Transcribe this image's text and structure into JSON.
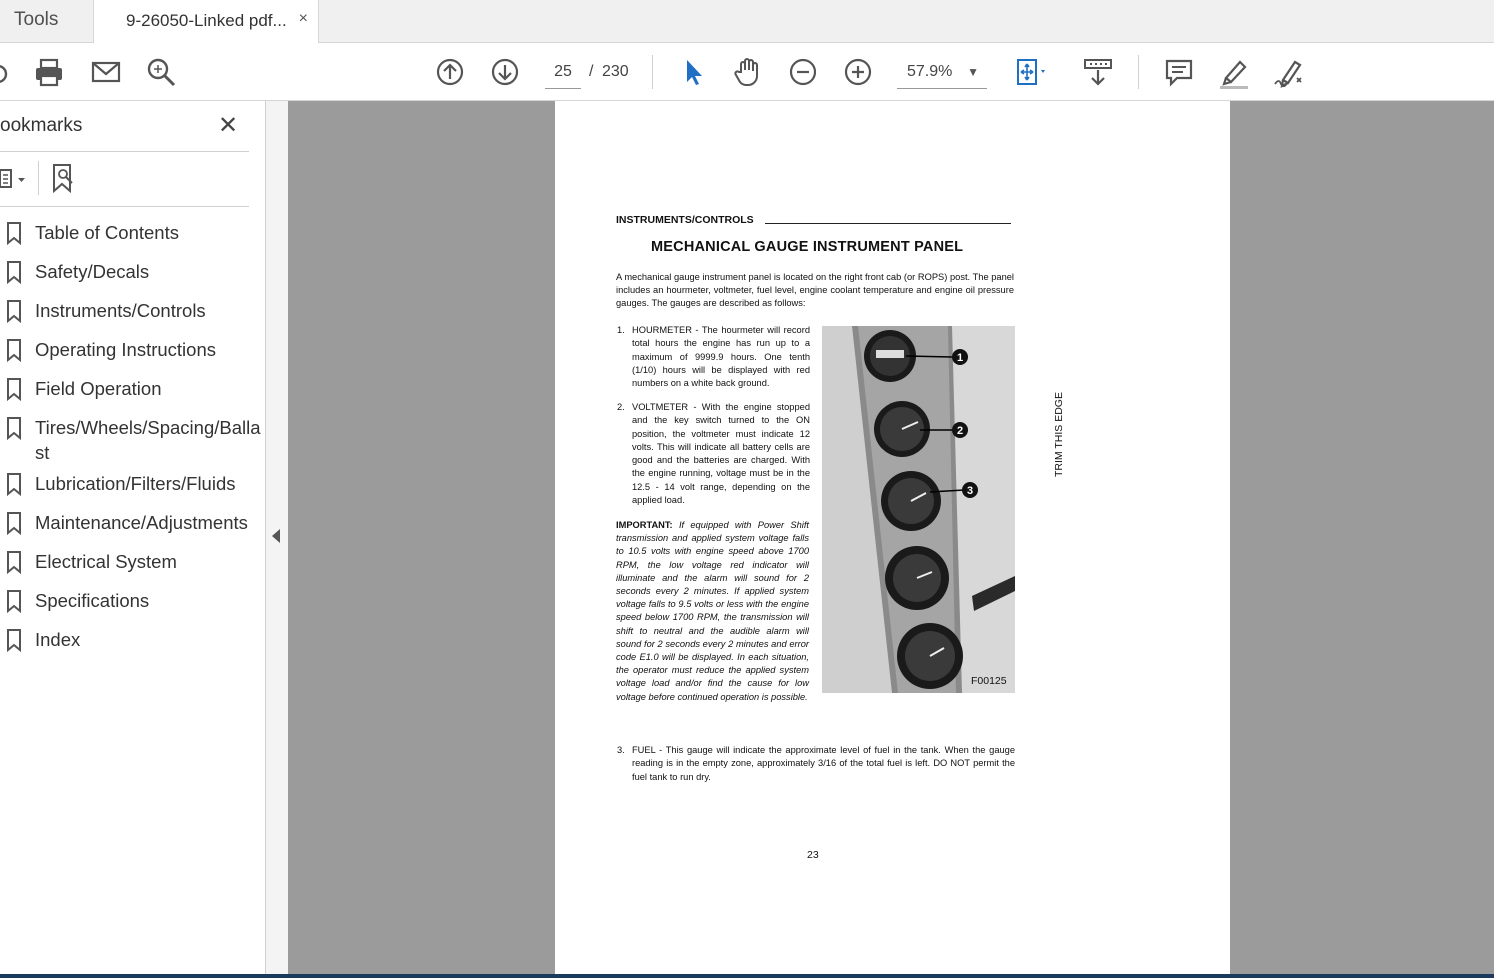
{
  "tabs": {
    "tools": "Tools",
    "document": "9-26050-Linked pdf...",
    "close": "×"
  },
  "toolbar": {
    "page_current": "25",
    "page_separator": "/",
    "page_total": "230",
    "zoom": "57.9%"
  },
  "sidebar": {
    "title": "ookmarks",
    "close": "✕",
    "items": [
      {
        "label": "Table of Contents"
      },
      {
        "label": "Safety/Decals"
      },
      {
        "label": "Instruments/Controls"
      },
      {
        "label": "Operating Instructions"
      },
      {
        "label": "Field Operation"
      },
      {
        "label": "Tires/Wheels/Spacing/Ballast"
      },
      {
        "label": "Lubrication/Filters/Fluids"
      },
      {
        "label": "Maintenance/Adjustments"
      },
      {
        "label": "Electrical System"
      },
      {
        "label": "Specifications"
      },
      {
        "label": "Index"
      }
    ]
  },
  "pdf": {
    "section": "INSTRUMENTS/CONTROLS",
    "heading": "MECHANICAL GAUGE INSTRUMENT PANEL",
    "intro": "A mechanical gauge instrument panel is located on the right front cab (or ROPS) post. The panel includes an hourmeter, voltmeter, fuel level, engine coolant temperature and engine oil pressure gauges. The gauges are described as follows:",
    "item1_num": "1.",
    "item1": "HOURMETER - The hourmeter will record total hours the engine has run up to a maximum of 9999.9 hours. One tenth (1/10) hours will be displayed with red numbers on a white back ground.",
    "item2_num": "2.",
    "item2": "VOLTMETER - With the engine stopped and the key switch turned to the ON position, the voltmeter must indicate 12 volts. This will indicate all battery cells are good and the batteries are charged. With the engine running, voltage must be in the 12.5 - 14 volt range, depending on the applied load.",
    "important_label": "IMPORTANT:",
    "important_text": "If equipped with Power Shift transmission and applied system voltage falls to 10.5 volts with engine speed above 1700 RPM, the low voltage red indicator will illuminate and the alarm will sound for 2 seconds every 2 minutes. If applied system voltage falls to 9.5 volts or less with the engine speed below 1700 RPM, the transmission will shift to neutral and the audible alarm will sound for 2 seconds every 2 minutes and error code E1.0 will be displayed. In each situation, the operator must reduce the applied system voltage load and/or find the cause for low voltage before continued operation is possible.",
    "item3_num": "3.",
    "item3": "FUEL - This gauge will indicate the approximate level of fuel in the tank. When the gauge reading is in the empty zone, approximately 3/16 of the total fuel is left. DO NOT permit the fuel tank to run dry.",
    "page_number": "23",
    "trim": "TRIM THIS EDGE",
    "figure_code": "F00125",
    "callouts": [
      "1",
      "2",
      "3"
    ]
  },
  "colors": {
    "doc_background": "#9b9b9b",
    "accent_blue": "#1f6fc5",
    "icon_gray": "#555555"
  }
}
